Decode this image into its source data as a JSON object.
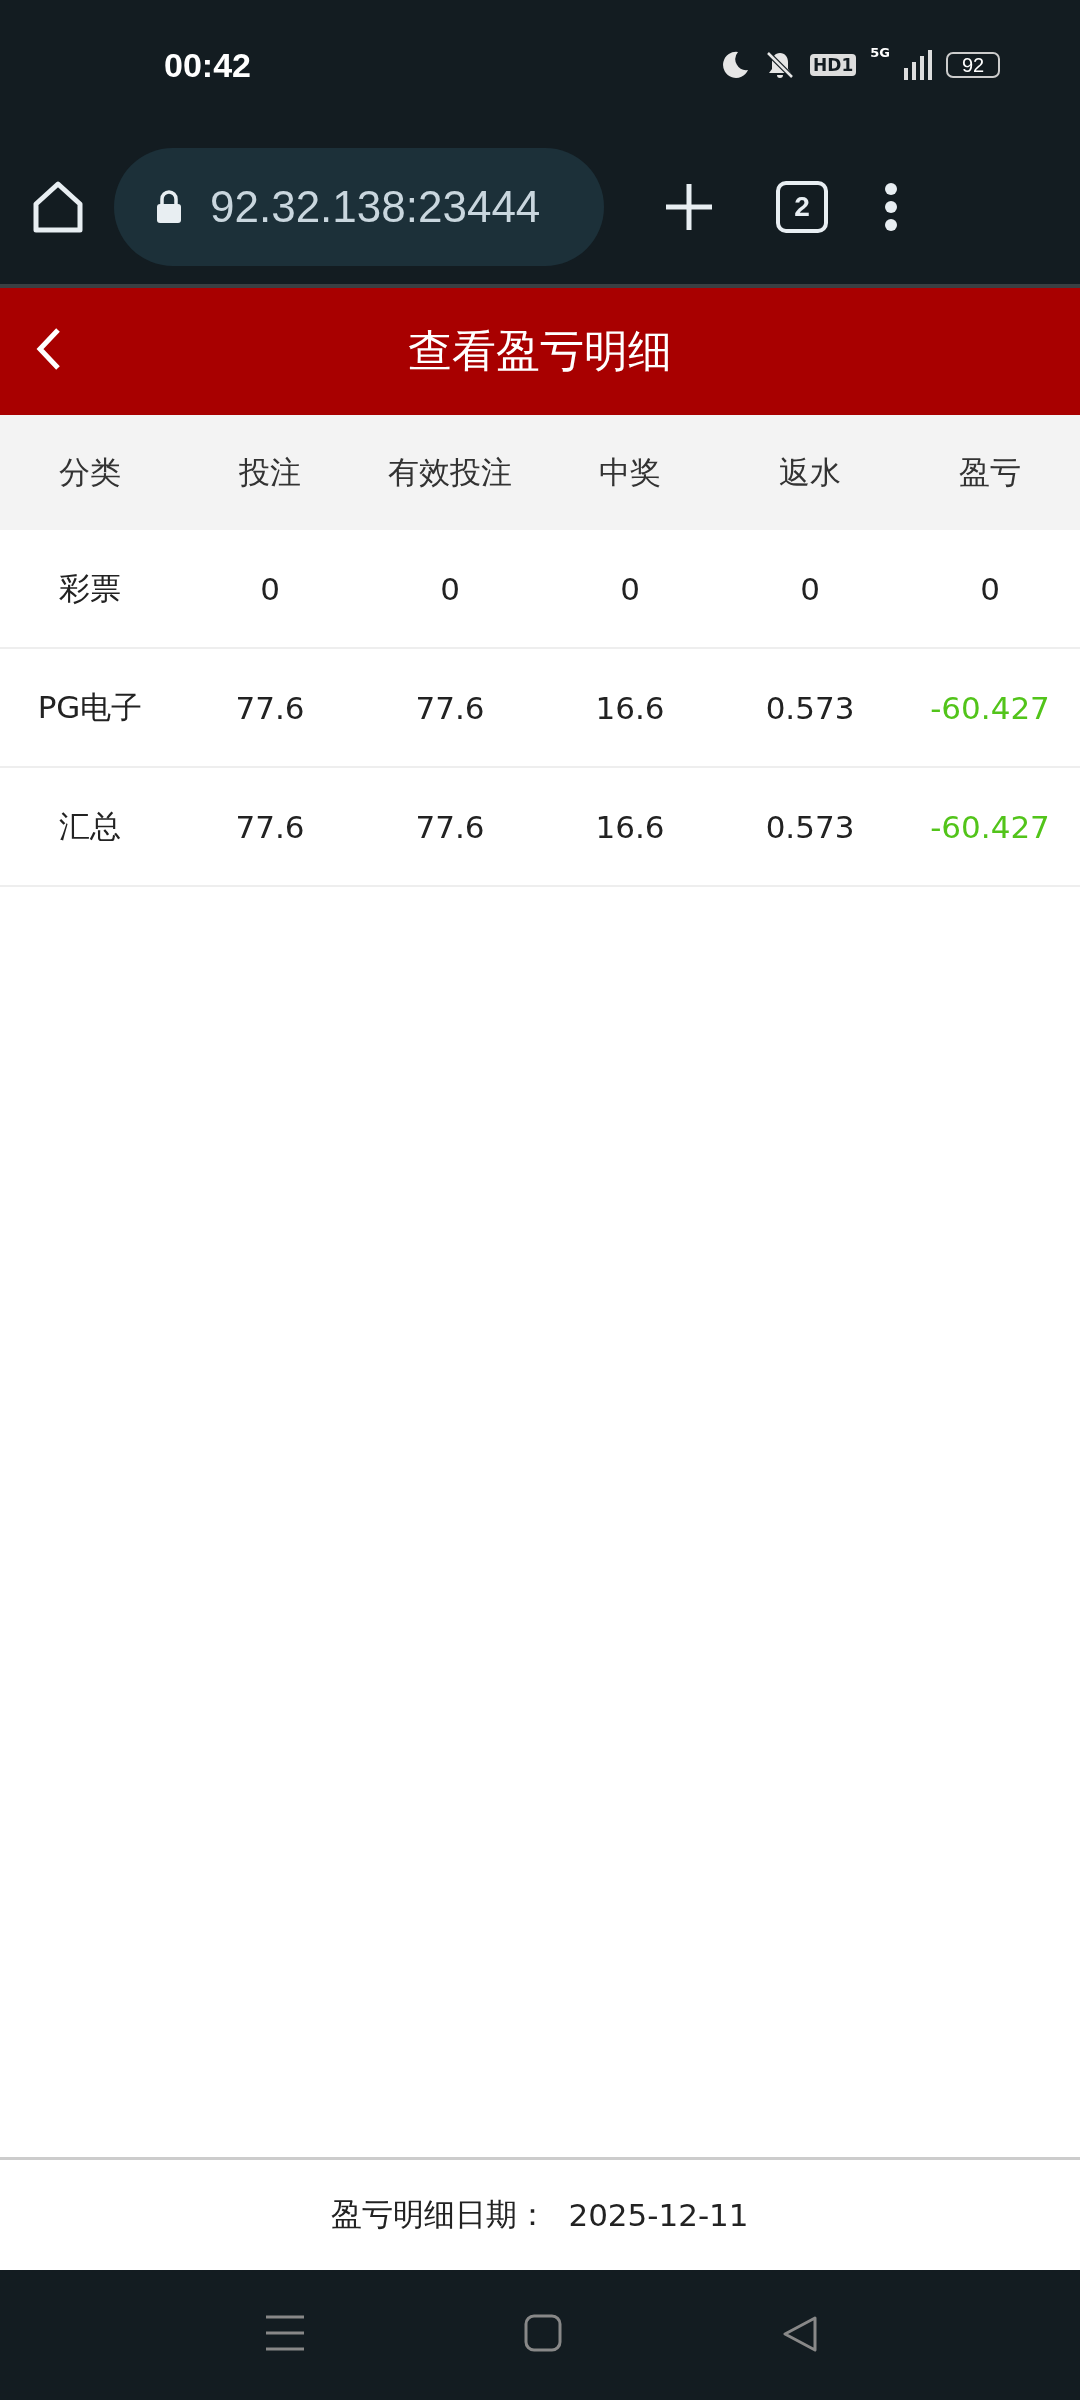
{
  "status_bar": {
    "time": "00:42",
    "hd_label": "HD1",
    "network": "5G",
    "battery": "92"
  },
  "browser": {
    "url": "92.32.138:23444",
    "tab_count": "2"
  },
  "header": {
    "title": "查看盈亏明细"
  },
  "table": {
    "columns": [
      "分类",
      "投注",
      "有效投注",
      "中奖",
      "返水",
      "盈亏"
    ],
    "rows": [
      {
        "cells": [
          "彩票",
          "0",
          "0",
          "0",
          "0"
        ],
        "profit": {
          "value": "0",
          "kind": "neutral"
        }
      },
      {
        "cells": [
          "PG电子",
          "77.6",
          "77.6",
          "16.6",
          "0.573"
        ],
        "profit": {
          "value": "-60.427",
          "kind": "loss"
        }
      },
      {
        "cells": [
          "汇总",
          "77.6",
          "77.6",
          "16.6",
          "0.573"
        ],
        "profit": {
          "value": "-60.427",
          "kind": "loss"
        }
      }
    ]
  },
  "footer": {
    "label": "盈亏明细日期：",
    "date": "2025-12-11"
  }
}
